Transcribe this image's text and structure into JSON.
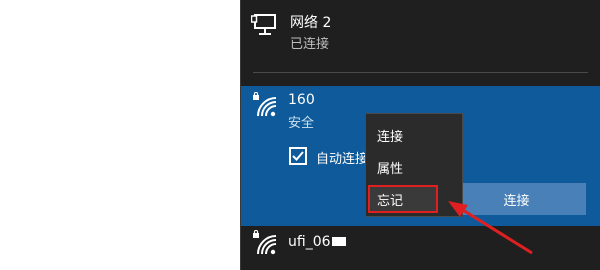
{
  "networks": [
    {
      "name": "网络 2",
      "status": "已连接",
      "icon": "ethernet-monitor-icon"
    },
    {
      "name": "160",
      "status": "安全",
      "icon": "wifi-secured-icon"
    },
    {
      "name": "ufi_06",
      "icon": "wifi-secured-icon"
    }
  ],
  "selected_network": {
    "auto_connect_label": "自动连接",
    "auto_connect_checked": true,
    "connect_button": "连接"
  },
  "context_menu": {
    "items": [
      "连接",
      "属性",
      "忘记"
    ],
    "highlighted": "忘记"
  },
  "colors": {
    "flyout_bg": "#1f1f1f",
    "selected_bg": "#0e5a9a",
    "button_bg": "#4a80b8",
    "menu_bg": "#2b2b2b",
    "highlight_border": "#e02020",
    "arrow": "#e02020"
  }
}
